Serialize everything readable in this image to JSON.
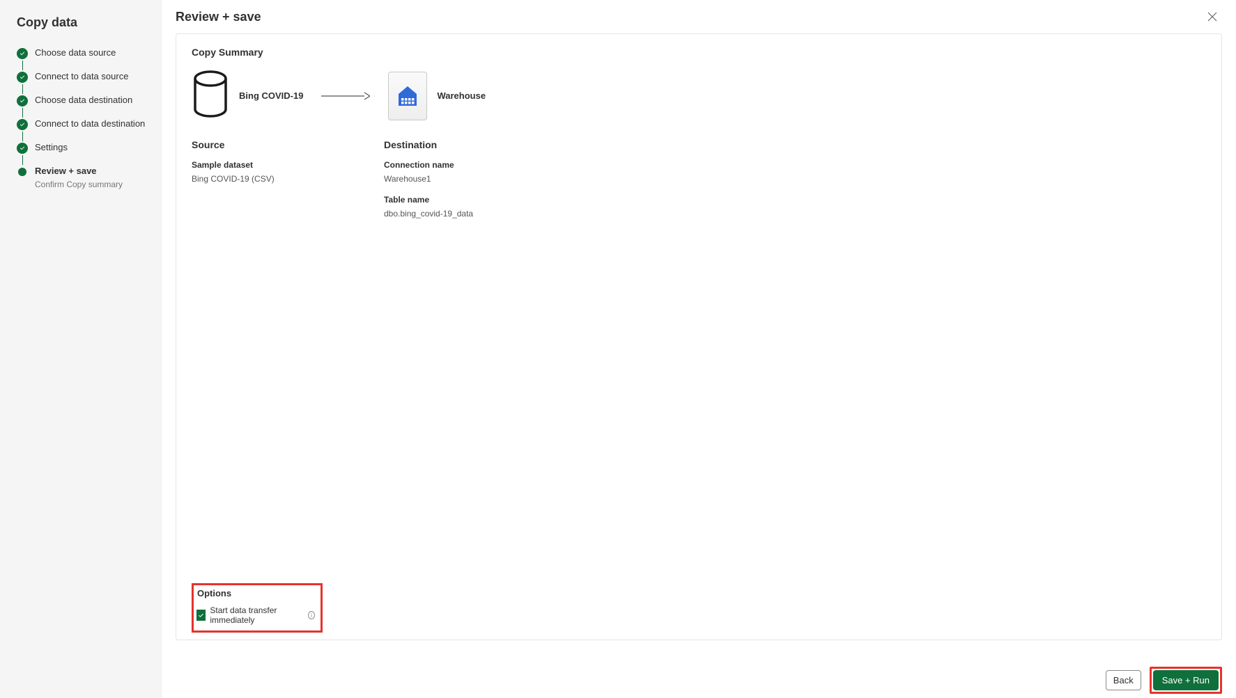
{
  "sidebar": {
    "title": "Copy data",
    "steps": [
      {
        "label": "Choose data source",
        "status": "done"
      },
      {
        "label": "Connect to data source",
        "status": "done"
      },
      {
        "label": "Choose data destination",
        "status": "done"
      },
      {
        "label": "Connect to data destination",
        "status": "done"
      },
      {
        "label": "Settings",
        "status": "done"
      },
      {
        "label": "Review + save",
        "sub": "Confirm Copy summary",
        "status": "current"
      }
    ]
  },
  "header": {
    "title": "Review + save"
  },
  "summary": {
    "section_title": "Copy Summary",
    "source_label": "Bing COVID-19",
    "destination_label": "Warehouse",
    "source": {
      "heading": "Source",
      "fields": {
        "sample_dataset_label": "Sample dataset",
        "sample_dataset_value": "Bing COVID-19 (CSV)"
      }
    },
    "destination": {
      "heading": "Destination",
      "fields": {
        "connection_name_label": "Connection name",
        "connection_name_value": "Warehouse1",
        "table_name_label": "Table name",
        "table_name_value": "dbo.bing_covid-19_data"
      }
    }
  },
  "options": {
    "heading": "Options",
    "checkbox_label": "Start data transfer immediately",
    "checked": true
  },
  "footer": {
    "back": "Back",
    "save_run": "Save + Run"
  }
}
